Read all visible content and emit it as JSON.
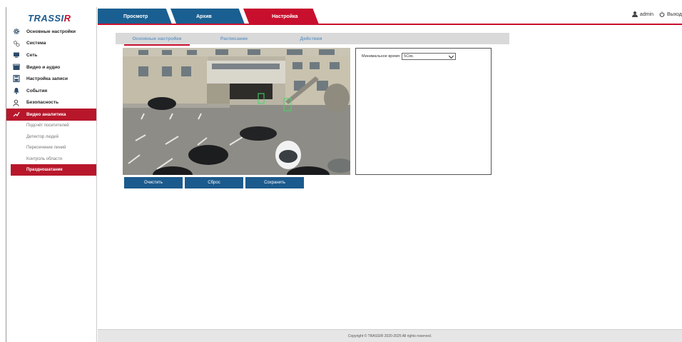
{
  "logo": {
    "text_main": "TRASSI",
    "text_accent": "R"
  },
  "nav": {
    "tabs": [
      {
        "label": "Просмотр"
      },
      {
        "label": "Архив"
      },
      {
        "label": "Настройка"
      }
    ],
    "active_tab": "Настройка"
  },
  "header": {
    "user": "admin",
    "logout": "Выход",
    "user_icon": "user-icon",
    "logout_icon": "power-icon"
  },
  "sidebar": {
    "items": [
      {
        "label": "Основные настройки",
        "icon": "gear-icon"
      },
      {
        "label": "Система",
        "icon": "system-gears-icon"
      },
      {
        "label": "Сеть",
        "icon": "network-icon"
      },
      {
        "label": "Видео и аудио",
        "icon": "video-audio-icon"
      },
      {
        "label": "Настройка записи",
        "icon": "record-icon"
      },
      {
        "label": "События",
        "icon": "bell-icon"
      },
      {
        "label": "Безопасность",
        "icon": "security-user-icon"
      },
      {
        "label": "Видео аналитика",
        "icon": "analytics-icon",
        "active": true
      }
    ],
    "subitems": [
      {
        "label": "Подсчёт посетителей"
      },
      {
        "label": "Детектор людей"
      },
      {
        "label": "Пересечение линий"
      },
      {
        "label": "Контроль области"
      },
      {
        "label": "Праздношатание",
        "active": true
      }
    ]
  },
  "subtabs": [
    {
      "label": "Основные настройки",
      "active": true
    },
    {
      "label": "Расписание"
    },
    {
      "label": "Действия"
    }
  ],
  "settings": {
    "min_time_label": "Минимальное время",
    "min_time_value": "5Сек."
  },
  "buttons": {
    "clear": "Очистить",
    "reset": "Сброс",
    "save": "Сохранить"
  },
  "footer": {
    "copyright": "Copyright © TRASSIR 2020-2025 All rights reserved."
  },
  "colors": {
    "brand_blue": "#1a5f91",
    "brand_red": "#c8102e",
    "subtab_text": "#6b9bc6"
  }
}
